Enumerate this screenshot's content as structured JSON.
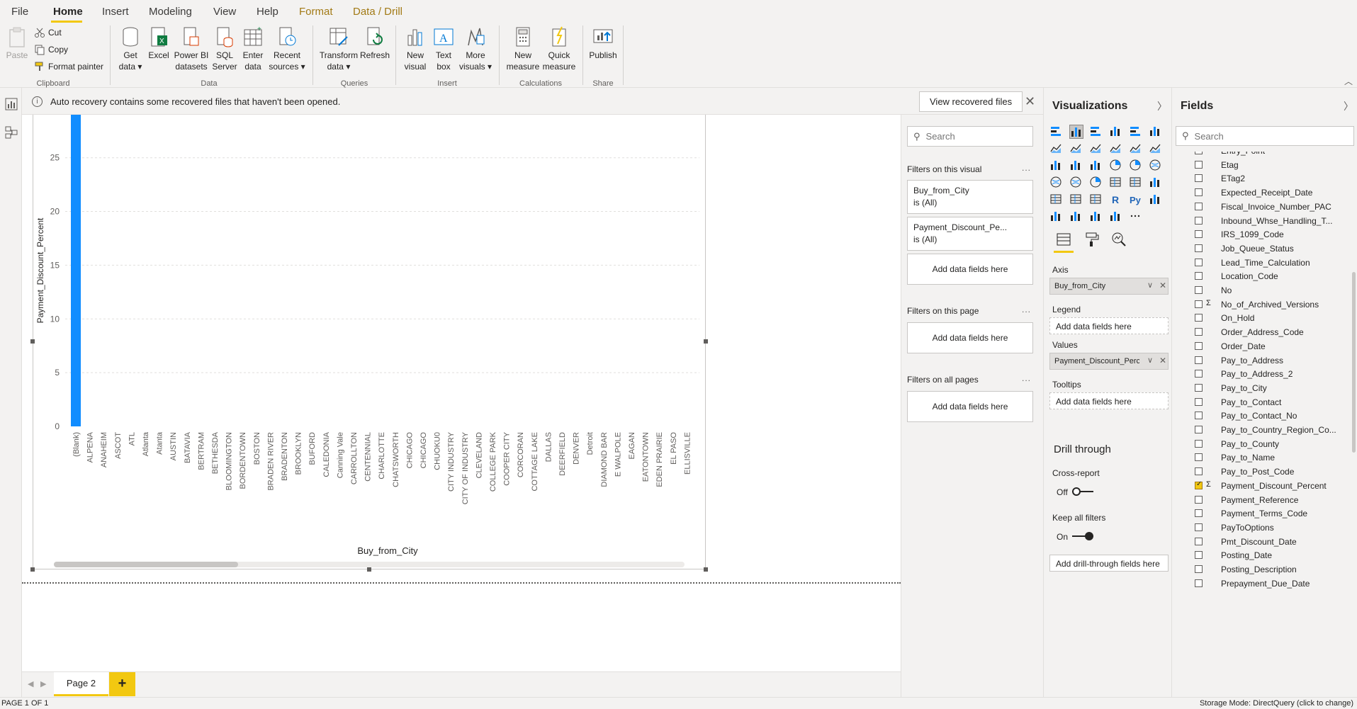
{
  "menu": {
    "tabs": [
      {
        "label": "File"
      },
      {
        "label": "Home"
      },
      {
        "label": "Insert"
      },
      {
        "label": "Modeling"
      },
      {
        "label": "View"
      },
      {
        "label": "Help"
      },
      {
        "label": "Format"
      },
      {
        "label": "Data / Drill"
      }
    ]
  },
  "ribbon": {
    "clipboard": {
      "paste": "Paste",
      "cut": "Cut",
      "copy": "Copy",
      "format_painter": "Format painter",
      "label": "Clipboard"
    },
    "data": {
      "get_data": "Get\ndata ▾",
      "excel": "Excel",
      "pbi_datasets": "Power BI\ndatasets",
      "sql_server": "SQL\nServer",
      "enter_data": "Enter\ndata",
      "recent_sources": "Recent\nsources ▾",
      "label": "Data"
    },
    "queries": {
      "transform": "Transform\ndata ▾",
      "refresh": "Refresh",
      "label": "Queries"
    },
    "insert": {
      "new_visual": "New\nvisual",
      "text_box": "Text\nbox",
      "more_visuals": "More\nvisuals ▾",
      "label": "Insert"
    },
    "calculations": {
      "new_measure": "New\nmeasure",
      "quick_measure": "Quick\nmeasure",
      "label": "Calculations"
    },
    "share": {
      "publish": "Publish",
      "label": "Share"
    }
  },
  "notification": {
    "text": "Auto recovery contains some recovered files that haven't been opened.",
    "button": "View recovered files"
  },
  "chart_data": {
    "type": "bar",
    "xlabel": "Buy_from_City",
    "ylabel": "Payment_Discount_Percent",
    "yticks": [
      0,
      5,
      10,
      15,
      20,
      25
    ],
    "ylim": [
      0,
      29
    ],
    "grid": true,
    "bar_color": "#118dff",
    "categories": [
      "(Blank)",
      "ALPENA",
      "ANAHEIM",
      "ASCOT",
      "ATL",
      "Atlanta",
      "Atanta",
      "AUSTIN",
      "BATAVIA",
      "BERTRAM",
      "BETHESDA",
      "BLOOMINGTON",
      "BORDENTOWN",
      "BOSTON",
      "BRADEN RIVER",
      "BRADENTON",
      "BROOKLYN",
      "BUFORD",
      "CALEDONIA",
      "Canning Vale",
      "CARROLLTON",
      "CENTENNIAL",
      "CHARLOTTE",
      "CHATSWORTH",
      "CHICAGO",
      "CHICAGO",
      "CHUOKU0",
      "CITY INDUSTRY",
      "CITY OF INDUSTRY",
      "CLEVELAND",
      "COLLEGE PARK",
      "COOPER CITY",
      "CORCORAN",
      "COTTAGE LAKE",
      "DALLAS",
      "DEERFIELD",
      "DENVER",
      "Detroit",
      "DIAMOND BAR",
      "E WALPOLE",
      "EAGAN",
      "EATONTOWN",
      "EDEN PRAIRIE",
      "EL PASO",
      "ELLISVILLE"
    ],
    "values": [
      29,
      0,
      0,
      0,
      0,
      0,
      0,
      0,
      0,
      0,
      0,
      0,
      0,
      0,
      0,
      0,
      0,
      0,
      0,
      0,
      0,
      0,
      0,
      0,
      0,
      0,
      0,
      0,
      0,
      0,
      0,
      0,
      0,
      0,
      0,
      0,
      0,
      0,
      0,
      0,
      0,
      0,
      0,
      0,
      0
    ]
  },
  "page_tabs": {
    "page": "Page 2",
    "add": "+"
  },
  "status": {
    "page": "PAGE 1 OF 1",
    "storage": "Storage Mode: DirectQuery (click to change)"
  },
  "filters": {
    "search_placeholder": "Search",
    "on_visual": "Filters on this visual",
    "cards": [
      {
        "field": "Buy_from_City",
        "state": "is (All)"
      },
      {
        "field": "Payment_Discount_Pe...",
        "state": "is (All)"
      }
    ],
    "add": "Add data fields here",
    "on_page": "Filters on this page",
    "on_all": "Filters on all pages",
    "more": "..."
  },
  "viz": {
    "title": "Visualizations",
    "axis": "Axis",
    "axis_field": "Buy_from_City",
    "legend": "Legend",
    "values": "Values",
    "values_field": "Payment_Discount_Perc",
    "tooltips": "Tooltips",
    "add": "Add data fields here",
    "drill_title": "Drill through",
    "cross_report": "Cross-report",
    "off": "Off",
    "keep_filters": "Keep all filters",
    "on": "On",
    "add_drill": "Add drill-through fields here",
    "more_icon": "..."
  },
  "fields": {
    "title": "Fields",
    "search_placeholder": "Search",
    "items": [
      {
        "name": "Entry_Point",
        "checked": false,
        "sigma": false
      },
      {
        "name": "Etag",
        "checked": false,
        "sigma": false
      },
      {
        "name": "ETag2",
        "checked": false,
        "sigma": false
      },
      {
        "name": "Expected_Receipt_Date",
        "checked": false,
        "sigma": false
      },
      {
        "name": "Fiscal_Invoice_Number_PAC",
        "checked": false,
        "sigma": false
      },
      {
        "name": "Inbound_Whse_Handling_T...",
        "checked": false,
        "sigma": false
      },
      {
        "name": "IRS_1099_Code",
        "checked": false,
        "sigma": false
      },
      {
        "name": "Job_Queue_Status",
        "checked": false,
        "sigma": false
      },
      {
        "name": "Lead_Time_Calculation",
        "checked": false,
        "sigma": false
      },
      {
        "name": "Location_Code",
        "checked": false,
        "sigma": false
      },
      {
        "name": "No",
        "checked": false,
        "sigma": false
      },
      {
        "name": "No_of_Archived_Versions",
        "checked": false,
        "sigma": true
      },
      {
        "name": "On_Hold",
        "checked": false,
        "sigma": false
      },
      {
        "name": "Order_Address_Code",
        "checked": false,
        "sigma": false
      },
      {
        "name": "Order_Date",
        "checked": false,
        "sigma": false
      },
      {
        "name": "Pay_to_Address",
        "checked": false,
        "sigma": false
      },
      {
        "name": "Pay_to_Address_2",
        "checked": false,
        "sigma": false
      },
      {
        "name": "Pay_to_City",
        "checked": false,
        "sigma": false
      },
      {
        "name": "Pay_to_Contact",
        "checked": false,
        "sigma": false
      },
      {
        "name": "Pay_to_Contact_No",
        "checked": false,
        "sigma": false
      },
      {
        "name": "Pay_to_Country_Region_Co...",
        "checked": false,
        "sigma": false
      },
      {
        "name": "Pay_to_County",
        "checked": false,
        "sigma": false
      },
      {
        "name": "Pay_to_Name",
        "checked": false,
        "sigma": false
      },
      {
        "name": "Pay_to_Post_Code",
        "checked": false,
        "sigma": false
      },
      {
        "name": "Payment_Discount_Percent",
        "checked": true,
        "sigma": true
      },
      {
        "name": "Payment_Reference",
        "checked": false,
        "sigma": false
      },
      {
        "name": "Payment_Terms_Code",
        "checked": false,
        "sigma": false
      },
      {
        "name": "PayToOptions",
        "checked": false,
        "sigma": false
      },
      {
        "name": "Pmt_Discount_Date",
        "checked": false,
        "sigma": false
      },
      {
        "name": "Posting_Date",
        "checked": false,
        "sigma": false
      },
      {
        "name": "Posting_Description",
        "checked": false,
        "sigma": false
      },
      {
        "name": "Prepayment_Due_Date",
        "checked": false,
        "sigma": false
      }
    ]
  }
}
